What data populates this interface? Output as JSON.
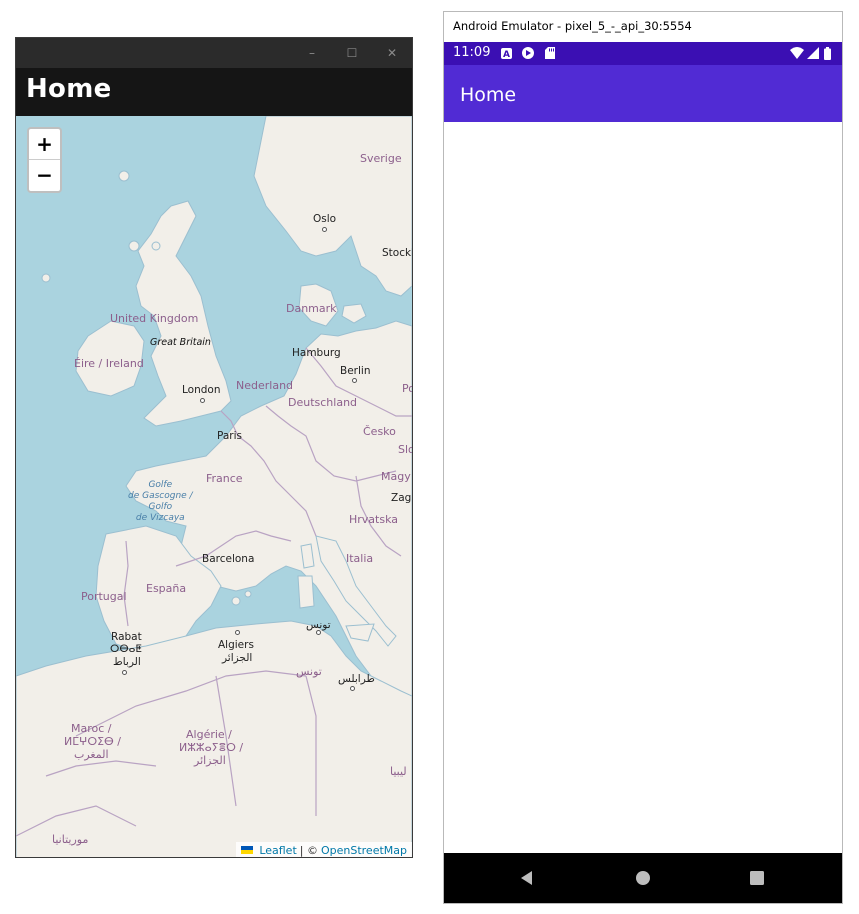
{
  "desktop": {
    "window_controls": {
      "minimize": "–",
      "maximize": "☐",
      "close": "✕"
    },
    "header_title": "Home",
    "map": {
      "zoom_in": "+",
      "zoom_out": "−",
      "labels": {
        "sverige": "Sverige",
        "oslo": "Oslo",
        "stockholm": "Stockh",
        "danmark": "Danmark",
        "united_kingdom": "United Kingdom",
        "great_britain": "Great Britain",
        "eire": "Éire / Ireland",
        "hamburg": "Hamburg",
        "berlin": "Berlin",
        "london": "London",
        "nederland": "Nederland",
        "polska": "Po",
        "deutschland": "Deutschland",
        "paris": "Paris",
        "cesko": "Česko",
        "slo": "Slo",
        "france": "France",
        "magyar": "Magy",
        "golfe": "Golfe\nde Gascogne /\nGolfo\nde Vizcaya",
        "zagreb": "Zagr",
        "hrvatska": "Hrvatska",
        "barcelona": "Barcelona",
        "italia": "Italia",
        "portugal": "Portugal",
        "espana": "España",
        "tunis": "تونس",
        "rabat": "Rabat",
        "rabat_tif": "ⵔⴱⴰⵟ",
        "rabat_ar": "الرباط",
        "algiers": "Algiers",
        "algiers_ar": "الجزائر",
        "tunisia": "تونس",
        "tripoli": "طرابلس",
        "maroc": "Maroc /",
        "maroc_tif": "ⵍⵎⵖⵔⵉⴱ /",
        "maroc_ar": "المغرب",
        "algerie": "Algérie /",
        "algerie_tif": "ⵍⵣⵣⴰⵢⴻⵔ /",
        "algerie_ar": "الجزائر",
        "libya": "ليبيا",
        "mauritania": "موريتانيا"
      },
      "attribution": {
        "leaflet": "Leaflet",
        "separator": "| ©",
        "osm": "OpenStreetMap"
      }
    }
  },
  "emulator": {
    "window_title": "Android Emulator - pixel_5_-_api_30:5554",
    "status_time": "11:09",
    "app_title": "Home"
  },
  "colors": {
    "sea": "#aad3df",
    "land": "#f2efe9",
    "border": "#b9a3c3",
    "app_bar": "#512bd4",
    "status_bar": "#3b0fb3",
    "nav_bar": "#000000"
  }
}
